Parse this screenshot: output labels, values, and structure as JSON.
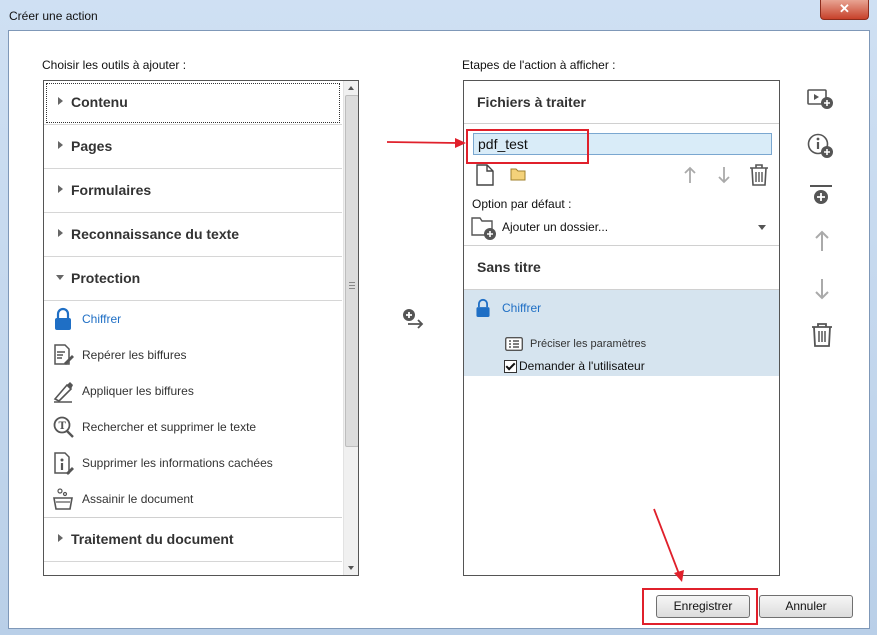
{
  "window": {
    "title": "Créer une action",
    "close_label": "✕"
  },
  "left": {
    "heading": "Choisir les outils à ajouter :",
    "categories": [
      {
        "label": "Contenu"
      },
      {
        "label": "Pages"
      },
      {
        "label": "Formulaires"
      },
      {
        "label": "Reconnaissance du texte"
      },
      {
        "label": "Protection"
      },
      {
        "label": "Traitement du document"
      }
    ],
    "tools": [
      {
        "label": "Chiffrer",
        "icon": "lock-icon"
      },
      {
        "label": "Repérer les biffures",
        "icon": "mark-redaction-icon"
      },
      {
        "label": "Appliquer les biffures",
        "icon": "apply-redaction-icon"
      },
      {
        "label": "Rechercher et supprimer le texte",
        "icon": "find-remove-text-icon"
      },
      {
        "label": "Supprimer les informations cachées",
        "icon": "remove-hidden-info-icon"
      },
      {
        "label": "Assainir le document",
        "icon": "sanitize-document-icon"
      }
    ]
  },
  "right": {
    "heading": "Etapes de l'action à afficher :",
    "files_section": "Fichiers à traiter",
    "file_name": "pdf_test",
    "default_option_label": "Option par défaut :",
    "default_option_value": "Ajouter un dossier...",
    "untitled_section": "Sans titre",
    "step_label": "Chiffrer",
    "step_settings": "Préciser les paramètres",
    "step_prompt": "Demander à l'utilisateur"
  },
  "buttons": {
    "save": "Enregistrer",
    "cancel": "Annuler"
  },
  "colors": {
    "accent": "#1f6fc5",
    "highlight_red": "#e0202b",
    "step_bg": "#d6e4ef"
  }
}
